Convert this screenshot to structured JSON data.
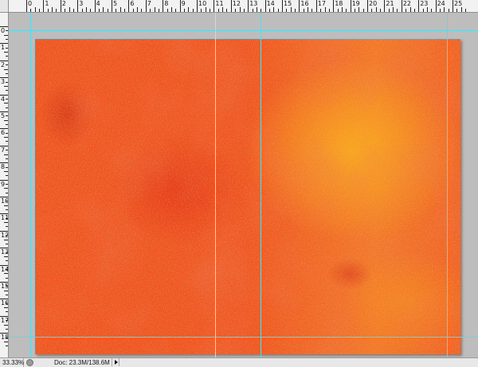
{
  "rulers": {
    "top_labels": [
      "0",
      "1",
      "2",
      "3",
      "4",
      "5",
      "6",
      "7",
      "8",
      "9",
      "10",
      "11",
      "12",
      "13",
      "14",
      "15",
      "16",
      "17",
      "18",
      "19",
      "20",
      "21",
      "22",
      "23",
      "24",
      "25"
    ],
    "left_labels": [
      "0",
      "1",
      "2",
      "3",
      "4",
      "5",
      "6",
      "7",
      "8",
      "9",
      "10",
      "11",
      "12",
      "13",
      "14",
      "15",
      "16",
      "17",
      "18"
    ]
  },
  "status": {
    "zoom": "33.33%",
    "doc_info": "Doc: 23.3M/138.6M"
  },
  "colors": {
    "document_base": "#ee5524",
    "document_highlight": "#f7a62b",
    "guide": "#5fd8e6",
    "pasteboard": "#bdbdbd"
  }
}
